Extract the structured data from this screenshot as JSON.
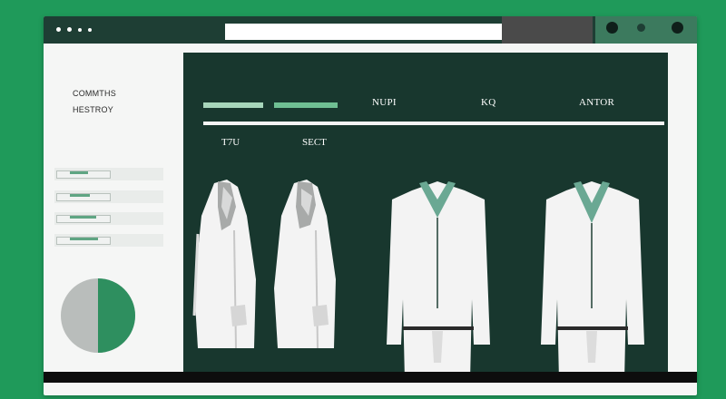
{
  "sidebar": {
    "brand_line1": "COMMTHS",
    "brand_line2": "HESTROY",
    "rows": [
      {
        "fill": 0.45
      },
      {
        "fill": 0.5
      },
      {
        "fill": 0.65
      },
      {
        "fill": 0.7
      }
    ],
    "pie": {
      "green_fraction": 0.5
    }
  },
  "main": {
    "columns": [
      "NUPI",
      "KQ",
      "ANTOR"
    ],
    "labels": [
      "T7U",
      "SECT"
    ],
    "garments": [
      {
        "name": "white-coat-1"
      },
      {
        "name": "white-coat-2"
      },
      {
        "name": "white-suit-jacket-1"
      },
      {
        "name": "white-suit-jacket-2"
      }
    ]
  },
  "colors": {
    "background": "#1f9a5a",
    "panel": "#18372e",
    "accent": "#6fbf93",
    "titlebar": "#1e3e34"
  }
}
